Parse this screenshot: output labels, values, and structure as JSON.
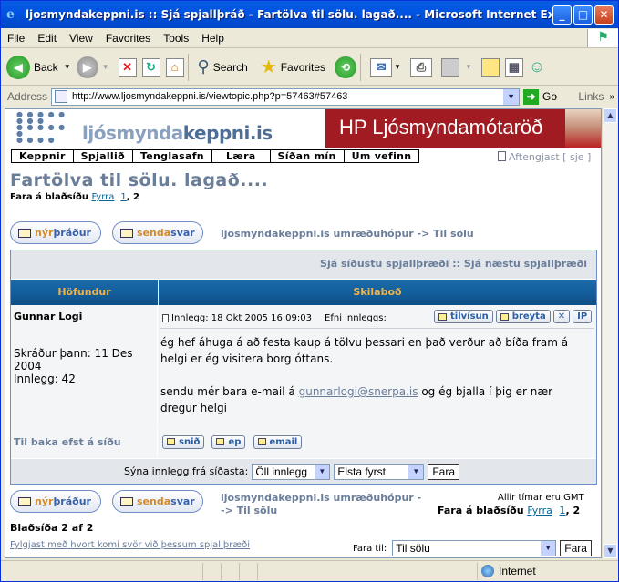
{
  "window": {
    "title": "ljosmyndakeppni.is :: Sjá spjallþráð - Fartölva til sölu. lagað.... - Microsoft Internet Explorer",
    "minimize": "_",
    "maximize": "□",
    "close": "✕"
  },
  "menu": [
    "File",
    "Edit",
    "View",
    "Favorites",
    "Tools",
    "Help"
  ],
  "toolbar": {
    "back": "Back",
    "search": "Search",
    "favorites": "Favorites"
  },
  "address": {
    "label": "Address",
    "url": "http://www.ljosmyndakeppni.is/viewtopic.php?p=57463#57463",
    "go": "Go",
    "links": "Links"
  },
  "site": {
    "logo_light": "ljósmynda",
    "logo_bold": "keppni.is",
    "ad_text": "HP Ljósmyndamótaröð",
    "nav": [
      "Keppnir",
      "Spjallið",
      "Tenglasafn",
      "Læra",
      "Síðan mín",
      "Um vefinn"
    ],
    "logout": "Aftengjast [ sje ]"
  },
  "topic": {
    "title": "Fartölva til sölu. lagað....",
    "goto_label": "Fara á blaðsíðu",
    "prev": "Fyrra",
    "page1": "1",
    "page_sep": ",",
    "page2": "2",
    "new_topic_a": "nýr",
    "new_topic_b": "þráður",
    "reply_a": "senda",
    "reply_b": "svar",
    "crumb_top": "ljosmyndakeppni.is umræðuhópur -> Til sölu",
    "crumb_bottom_1": "ljosmyndakeppni.is umræðuhópur -",
    "crumb_bottom_2": "-> Til sölu",
    "prev_next": "Sjá síðustu spjallþræði :: Sjá næstu spjallþræði",
    "col_author": "Höfundur",
    "col_message": "Skilaboð"
  },
  "post": {
    "author": "Gunnar Logi",
    "registered": "Skráður þann: 11 Des 2004",
    "posts": "Innlegg: 42",
    "meta": "Innlegg: 18 Okt 2005 16:09:03",
    "subject_label": "Efni innleggs:",
    "quote": "tilvísun",
    "edit": "breyta",
    "delete": "✕",
    "ip": "IP",
    "body_1": "ég hef áhuga á að festa kaup á tölvu þessari en það verður að bíða fram á helgi er ég visitera borg óttans.",
    "body_2_pre": "sendu mér bara e-mail á",
    "email": "gunnarlogi@snerpa.is",
    "body_2_post": "og ég bjalla í þig er nær dregur helgi",
    "back_to_top": "Til baka efst á síðu",
    "profile": "snið",
    "pm": "ep",
    "mail": "email"
  },
  "filter": {
    "label": "Sýna innlegg frá síðasta:",
    "period": "Öll innlegg",
    "order": "Elsta fyrst",
    "go": "Fara"
  },
  "footer": {
    "timezone": "Allir tímar eru GMT",
    "page_of": "Blaðsíða 2 af 2",
    "watch": "Fylgjast með hvort komi svör við þessum spjallþræði",
    "jump_label": "Fara til:",
    "jump_value": "Til sölu",
    "jump_go": "Fara"
  },
  "status": {
    "zone": "Internet"
  },
  "colors": {
    "title_blue": "#6a7d99",
    "link": "#006699",
    "header_bar": "#145f9d",
    "header_text": "#f0b44a",
    "ad_red": "#a01c22"
  }
}
